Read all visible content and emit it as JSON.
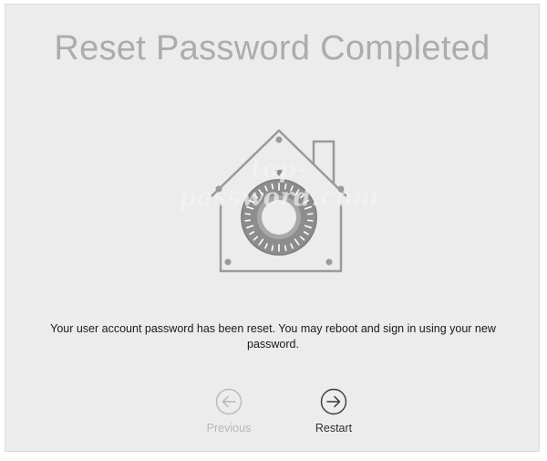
{
  "dialog": {
    "title": "Reset Password Completed",
    "message": "Your user account password has been reset. You may reboot and sign in using your new password.",
    "watermark": "top-password.com"
  },
  "icons": {
    "hero": "filevault-house-icon",
    "previous": "arrow-left-circle-icon",
    "restart": "arrow-right-circle-icon"
  },
  "buttons": {
    "previous_label": "Previous",
    "previous_enabled": false,
    "restart_label": "Restart",
    "restart_enabled": true
  },
  "colors": {
    "background": "#ececec",
    "title": "#acacac",
    "disabled": "#b8b8b8",
    "enabled": "#333333"
  }
}
